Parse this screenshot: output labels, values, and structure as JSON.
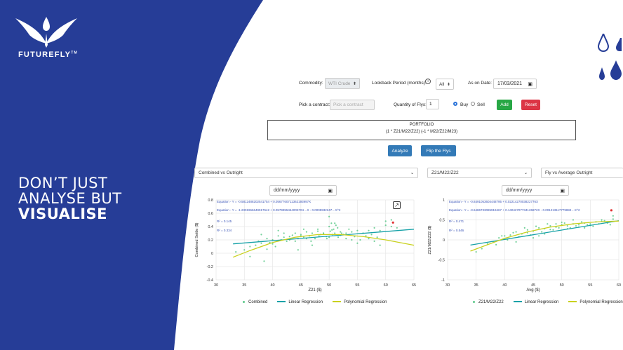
{
  "brand": {
    "name": "FUTUREFLY",
    "tm": "TM",
    "tagline": [
      "DON’T JUST",
      "ANALYSE BUT",
      "VISUALISE"
    ],
    "colors": {
      "navy": "#263d97",
      "drop": "#263d97"
    }
  },
  "form": {
    "commodity_label": "Commodity:",
    "commodity_value": "WTI Crude",
    "lookback_label": "Lookback Period (months):",
    "lookback_value": "All",
    "info_icon": "info-icon",
    "as_on_label": "As on Date:",
    "as_on_value": "17/03/2021",
    "contract_label": "Pick a contract:",
    "contract_placeholder": "Pick a contract",
    "qty_label": "Quantity of Flys:",
    "qty_value": "1",
    "buy_label": "Buy",
    "sell_label": "Sell",
    "add_label": "Add",
    "reset_label": "Reset"
  },
  "portfolio": {
    "title": "PORTFOLIO",
    "entry": "(1 * Z21/M22/Z22) (-1 * M22/Z22/M23)"
  },
  "actions": {
    "analyze": "Analyze",
    "flip": "Flip the Flys"
  },
  "dropdowns": {
    "left": "Combined vs Outright",
    "middle": "Z21/M22/Z22",
    "right": "Fly vs Average Outright"
  },
  "left_chart": {
    "date_placeholder": "dd/mm/yyyy",
    "equation1": "Equation - Y = -0.5812488202541754 + 0.0567760711362193997X",
    "equation2": "Equation - Y = -1.2301966649917642 + 0.0579955464005704…X - 0.0005932247…X^2",
    "r2_1": "R² = 0.145",
    "r2_2": "R² = 0.334",
    "expand_icon": "expand-icon",
    "legend": [
      "Combined",
      "Linear Regression",
      "Polynomial Regression"
    ]
  },
  "right_chart": {
    "date_placeholder": "dd/mm/yyyy",
    "equation1": "Equation - Y = -0.8491053604448795 + 0.0221427003822776X",
    "equation2": "Equation - Y = -3.6486733085919467 + 0.14042707734126872X - 0.001213117779884…X^2",
    "r2_1": "R² = 0.471",
    "r2_2": "R² = 0.546",
    "legend": [
      "Z21/M22/Z22",
      "Linear Regression",
      "Polynomial Regression"
    ]
  },
  "chart_data": [
    {
      "type": "scatter",
      "xlabel": "Z21 ($)",
      "ylabel": "Combined Settle ($)",
      "xlim": [
        30,
        65
      ],
      "ylim": [
        -0.4,
        0.8
      ],
      "x_ticks": [
        30,
        35,
        40,
        45,
        50,
        55,
        60,
        65
      ],
      "y_ticks": [
        -0.4,
        -0.2,
        0,
        0.2,
        0.4,
        0.6,
        0.8
      ],
      "y_tick_labels": [
        "-0.4",
        "-0.2",
        "0",
        "0.2",
        "0.4",
        "0.6",
        "0.8"
      ],
      "series": [
        {
          "name": "Combined",
          "kind": "points",
          "color": "#5cc98a",
          "x": [
            33.5,
            35,
            36,
            37,
            37.5,
            38,
            38.5,
            39,
            39.5,
            40,
            40.5,
            41,
            41.5,
            42,
            42.5,
            43,
            43.5,
            44,
            44.5,
            45,
            45.5,
            46,
            46.5,
            47,
            47.5,
            48,
            48.5,
            49,
            49.5,
            50,
            50.5,
            51,
            51.5,
            52,
            52.5,
            53,
            53.5,
            54,
            54.5,
            55,
            55.5,
            56,
            56.5,
            57,
            57.5,
            58,
            58.5,
            59,
            60,
            61,
            62,
            38,
            40,
            42,
            44,
            46,
            48,
            50,
            52,
            54,
            56,
            58,
            60,
            39,
            41,
            43,
            45,
            47,
            49,
            51,
            53,
            55,
            57,
            59,
            61,
            36,
            50,
            50.2,
            50.4,
            50.6,
            50.8,
            51.2,
            51.6,
            52.2,
            44.5,
            45.5,
            46.8,
            48.2,
            49.6
          ],
          "y": [
            0.02,
            0.05,
            0.1,
            0.12,
            0.18,
            0.15,
            -0.12,
            0.22,
            0.16,
            0.2,
            0.1,
            0.26,
            0.2,
            0.24,
            0.18,
            0.25,
            0.27,
            0.3,
            0.22,
            0.28,
            0.24,
            0.32,
            0.26,
            0.3,
            0.22,
            0.33,
            0.28,
            0.3,
            0.25,
            0.4,
            0.35,
            0.3,
            0.38,
            0.32,
            0.28,
            0.3,
            0.36,
            0.32,
            0.25,
            0.34,
            0.2,
            0.3,
            0.26,
            0.22,
            0.28,
            0.18,
            0.24,
            0.34,
            0.42,
            0.4,
            0.38,
            0.28,
            0.14,
            0.3,
            0.18,
            0.22,
            0.36,
            0.24,
            0.27,
            0.2,
            0.3,
            0.38,
            0.48,
            0.06,
            0.34,
            0.2,
            0.26,
            0.12,
            0.3,
            0.45,
            0.22,
            0.15,
            0.34,
            0.12,
            0.5,
            -0.05,
            0.55,
            0.33,
            0.45,
            0.28,
            0.36,
            0.42,
            0.24,
            0.3,
            0.05,
            0.36,
            0.18,
            0.26,
            0.22
          ]
        },
        {
          "name": "Linear Regression",
          "kind": "line",
          "color": "#17a2a8",
          "x": [
            33,
            65
          ],
          "y": [
            0.14,
            0.36
          ]
        },
        {
          "name": "Polynomial Regression",
          "kind": "line",
          "color": "#c9d11f",
          "x": [
            33,
            36,
            40,
            44,
            48,
            52,
            56,
            60,
            65
          ],
          "y": [
            -0.06,
            0.04,
            0.16,
            0.24,
            0.28,
            0.28,
            0.25,
            0.2,
            0.12
          ]
        }
      ],
      "highlight": {
        "x": 61.3,
        "y": 0.46,
        "color": "#e03030"
      }
    },
    {
      "type": "scatter",
      "xlabel": "Avg ($)",
      "ylabel": "Z21/M22/Z22 ($)",
      "xlim": [
        30,
        60
      ],
      "ylim": [
        -1,
        1
      ],
      "x_ticks": [
        30,
        35,
        40,
        45,
        50,
        55,
        60
      ],
      "y_ticks": [
        -1,
        -0.5,
        0,
        0.5,
        1
      ],
      "y_tick_labels": [
        "-1",
        "-0.5",
        "0",
        "0.5",
        "1"
      ],
      "series": [
        {
          "name": "Z21/M22/Z22",
          "kind": "points",
          "color": "#5cc98a",
          "x": [
            35,
            36,
            37,
            38,
            39,
            40,
            41,
            42,
            43,
            44,
            45,
            46,
            47,
            48,
            49,
            50,
            51,
            52,
            53,
            54,
            55,
            56,
            57,
            58,
            59,
            40.5,
            41.5,
            42.5,
            43.5,
            44.5,
            45.5,
            46.5,
            47.5,
            48.5,
            49.5,
            50.5,
            51.5,
            52.5,
            53.5,
            54.5,
            55.5,
            56.5,
            57.5,
            58.5,
            45,
            47,
            49,
            51,
            53,
            55,
            57,
            59,
            38.5,
            39.5,
            42,
            44,
            46,
            48,
            50,
            52,
            54
          ],
          "y": [
            -0.3,
            -0.22,
            -0.1,
            -0.05,
            0.05,
            0.1,
            0.12,
            0.2,
            0.15,
            0.25,
            0.22,
            0.3,
            0.28,
            0.35,
            0.32,
            0.38,
            0.35,
            0.4,
            0.38,
            0.42,
            0.4,
            0.45,
            0.5,
            0.42,
            0.52,
            0.0,
            0.18,
            0.08,
            0.3,
            0.12,
            0.34,
            0.2,
            0.4,
            0.25,
            0.3,
            0.42,
            0.3,
            0.35,
            0.45,
            0.38,
            0.34,
            0.4,
            0.48,
            0.38,
            0.05,
            0.15,
            0.4,
            0.28,
            0.32,
            0.36,
            0.46,
            0.6,
            -0.12,
            0.1,
            -0.05,
            0.18,
            0.1,
            0.26,
            0.44,
            0.5,
            0.3
          ]
        },
        {
          "name": "Linear Regression",
          "kind": "line",
          "color": "#17a2a8",
          "x": [
            34,
            60
          ],
          "y": [
            -0.13,
            0.48
          ]
        },
        {
          "name": "Polynomial Regression",
          "kind": "line",
          "color": "#c9d11f",
          "x": [
            34,
            37,
            40,
            44,
            48,
            52,
            56,
            60
          ],
          "y": [
            -0.28,
            -0.12,
            0.04,
            0.2,
            0.32,
            0.4,
            0.45,
            0.47
          ]
        }
      ],
      "highlight": {
        "x": 58.7,
        "y": 0.74,
        "color": "#e03030"
      }
    }
  ]
}
